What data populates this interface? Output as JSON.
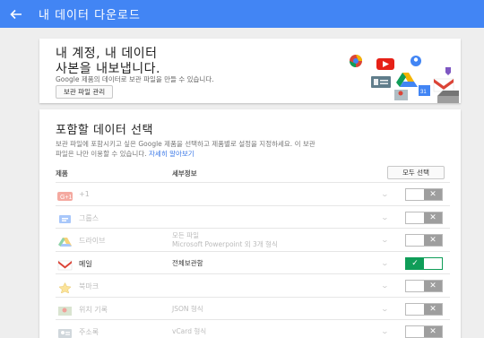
{
  "header": {
    "title": "내 데이터 다운로드",
    "back_icon": "arrow-left-icon"
  },
  "intro": {
    "title_line1": "내 계정, 내 데이터",
    "title_line2": "사본을 내보냅니다.",
    "description": "Google 제품의 데이터로 보관 파일을 만들 수 있습니다.",
    "button_label": "보관 파일 관리"
  },
  "select": {
    "title": "포함할 데이터 선택",
    "description_line1": "보관 파일에 포함시키고 싶은 Google 제품을 선택하고 제품별로 설정을 지정하세요. 이 보관",
    "description_line2": "파일은 나만 이용할 수 있습니다.",
    "learn_more": "자세히 알아보기",
    "col_product": "제품",
    "col_detail": "세부정보",
    "select_all_label": "모두 선택",
    "rows": [
      {
        "name": "+1",
        "icon": "google-plus-one-icon",
        "detail1": "",
        "detail2": "",
        "enabled": false
      },
      {
        "name": "그룹스",
        "icon": "groups-icon",
        "detail1": "",
        "detail2": "",
        "enabled": false
      },
      {
        "name": "드라이브",
        "icon": "drive-icon",
        "detail1": "모든 파일",
        "detail2": "Microsoft Powerpoint 외 3개 형식",
        "enabled": false
      },
      {
        "name": "메일",
        "icon": "gmail-icon",
        "detail1": "전체보관함",
        "detail2": "",
        "enabled": true
      },
      {
        "name": "북마크",
        "icon": "bookmark-star-icon",
        "detail1": "",
        "detail2": "",
        "enabled": false
      },
      {
        "name": "위치 기록",
        "icon": "location-history-icon",
        "detail1": "JSON 형식",
        "detail2": "",
        "enabled": false
      },
      {
        "name": "주소록",
        "icon": "contacts-icon",
        "detail1": "vCard 형식",
        "detail2": "",
        "enabled": false
      }
    ]
  }
}
